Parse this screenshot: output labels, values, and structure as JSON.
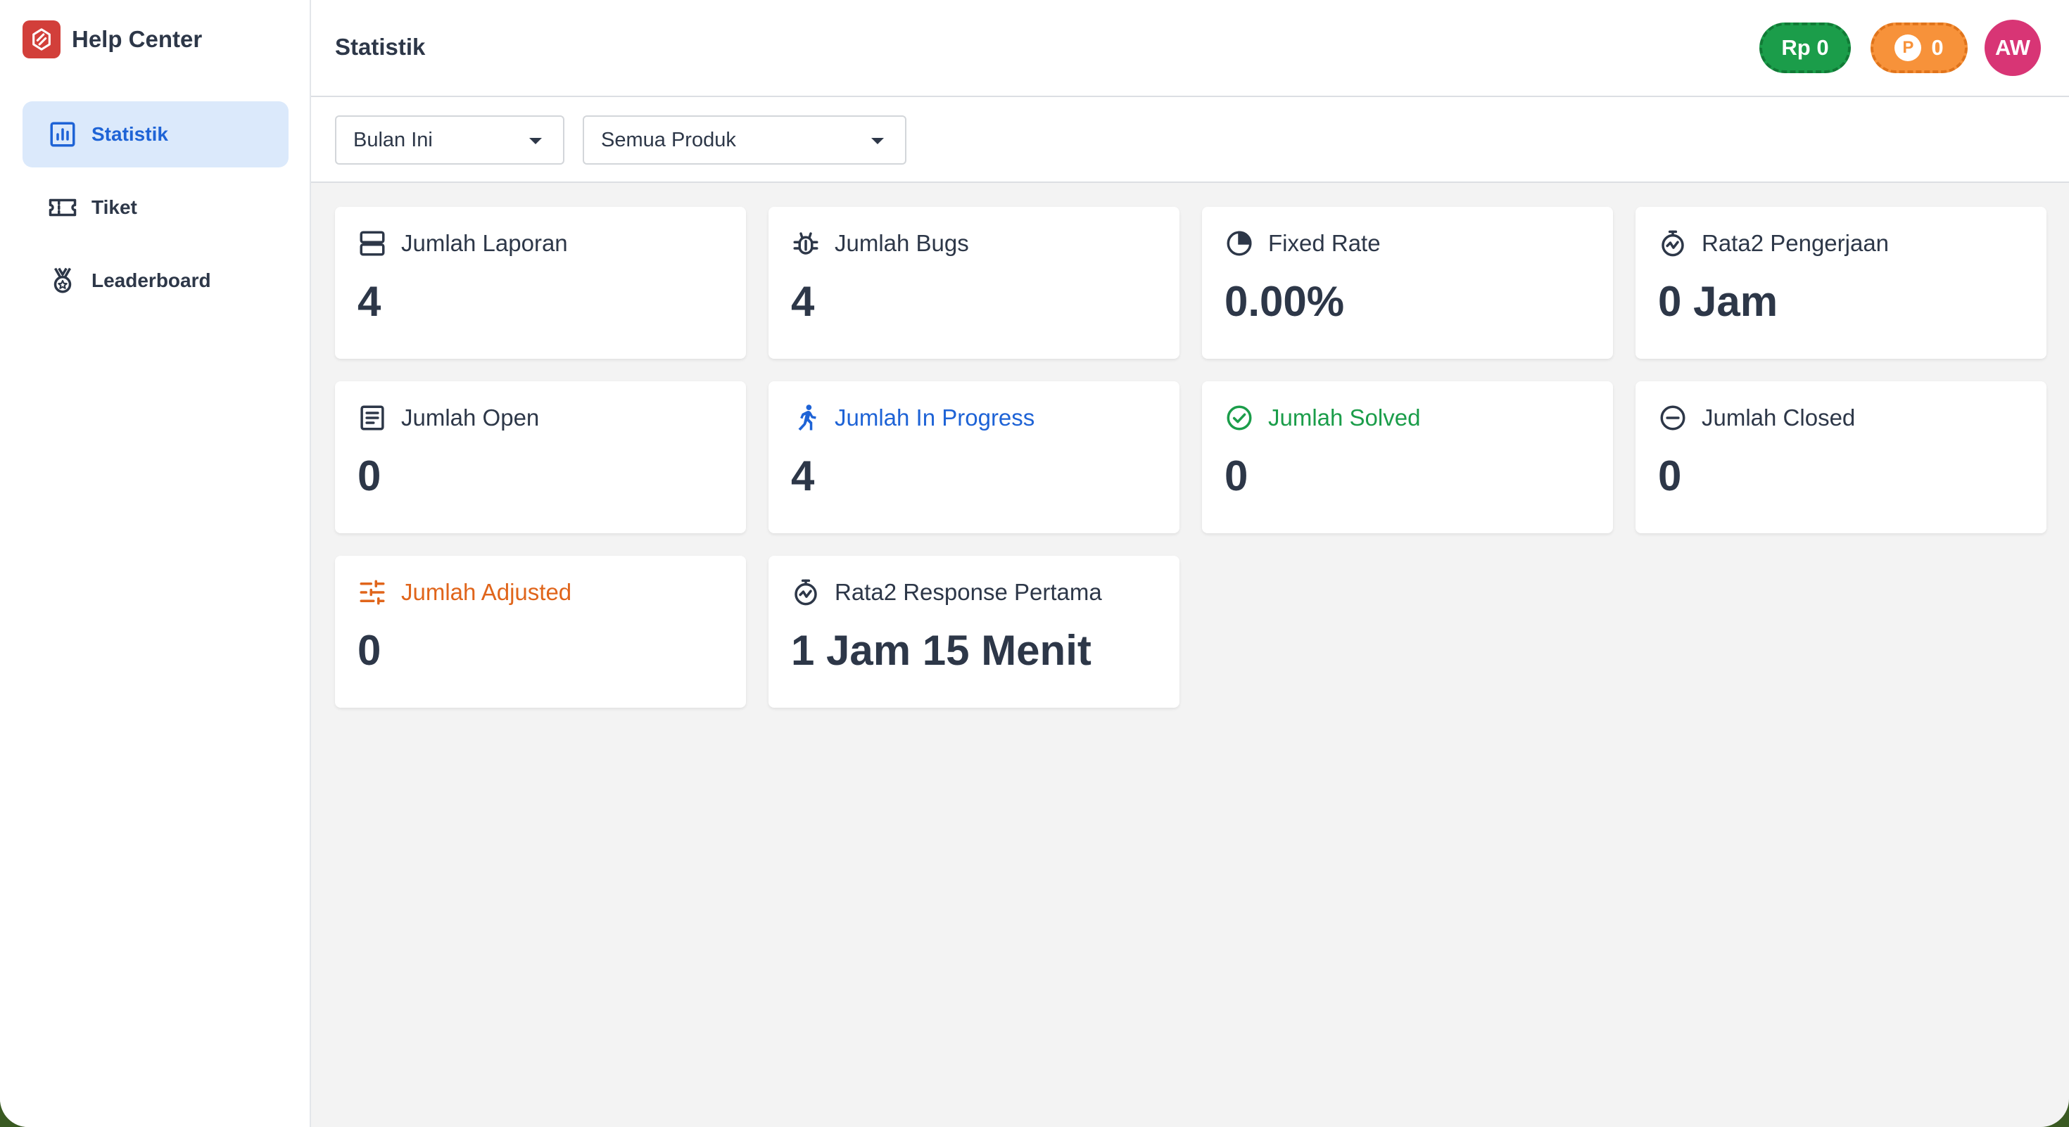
{
  "app": {
    "title": "Help Center"
  },
  "sidebar": {
    "items": [
      {
        "label": "Statistik",
        "icon": "bar-chart-icon",
        "active": true
      },
      {
        "label": "Tiket",
        "icon": "ticket-icon"
      },
      {
        "label": "Leaderboard",
        "icon": "medal-icon"
      }
    ]
  },
  "header": {
    "title": "Statistik",
    "balance": "Rp 0",
    "points": {
      "coin": "P",
      "value": "0"
    },
    "avatar_initials": "AW"
  },
  "filters": {
    "period": "Bulan Ini",
    "product": "Semua Produk"
  },
  "stats": [
    {
      "label": "Jumlah Laporan",
      "value": "4",
      "icon": "server-icon"
    },
    {
      "label": "Jumlah Bugs",
      "value": "4",
      "icon": "bug-icon"
    },
    {
      "label": "Fixed Rate",
      "value": "0.00%",
      "icon": "pie-chart-icon"
    },
    {
      "label": "Rata2 Pengerjaan",
      "value": "0 Jam",
      "icon": "stopwatch-icon"
    },
    {
      "label": "Jumlah Open",
      "value": "0",
      "icon": "document-icon"
    },
    {
      "label": "Jumlah In Progress",
      "value": "4",
      "icon": "running-person-icon",
      "color": "#1e63d6"
    },
    {
      "label": "Jumlah Solved",
      "value": "0",
      "icon": "check-circle-icon",
      "color": "#1b9d4a"
    },
    {
      "label": "Jumlah Closed",
      "value": "0",
      "icon": "minus-circle-icon"
    },
    {
      "label": "Jumlah Adjusted",
      "value": "0",
      "icon": "sliders-icon",
      "color": "#e0651b"
    },
    {
      "label": "Rata2 Response Pertama",
      "value": "1 Jam 15 Menit",
      "icon": "stopwatch-icon"
    }
  ],
  "colors": {
    "accent": "#1e63d6",
    "active_nav_bg": "#dbe9fb",
    "brand": "#d23f3a",
    "balance_pill": "#1b9d4a",
    "points_pill": "#f7923a",
    "avatar": "#d83575"
  }
}
